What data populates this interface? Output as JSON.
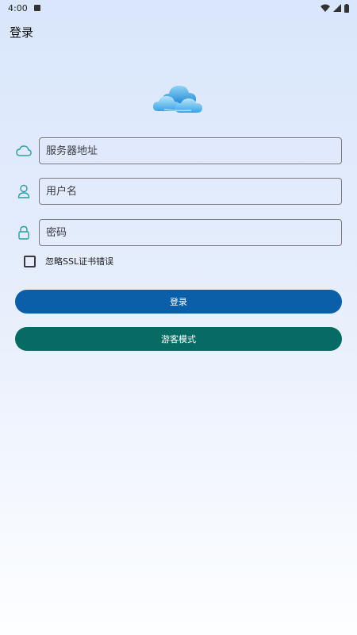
{
  "status_bar": {
    "time": "4:00"
  },
  "app_bar": {
    "title": "登录"
  },
  "form": {
    "server_placeholder": "服务器地址",
    "username_placeholder": "用户名",
    "password_placeholder": "密码",
    "ignore_ssl_label": "忽略SSL证书错误",
    "ignore_ssl_checked": false
  },
  "buttons": {
    "login_label": "登录",
    "guest_label": "游客模式"
  },
  "colors": {
    "login_button": "#0b5ea8",
    "guest_button": "#056b63",
    "icon_teal": "#2b9fa7"
  }
}
